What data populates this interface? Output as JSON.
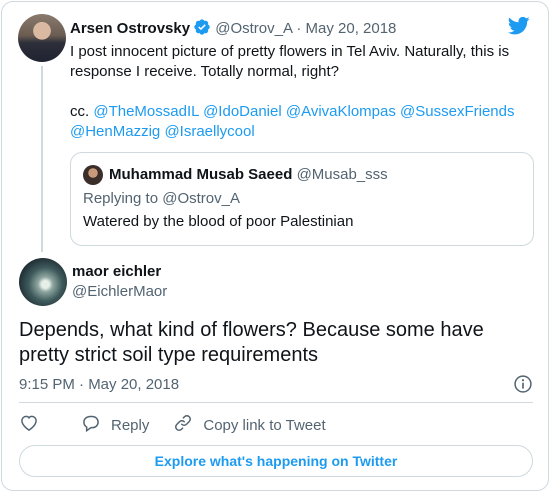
{
  "parent_tweet": {
    "author_name": "Arsen Ostrovsky",
    "author_handle": "@Ostrov_A",
    "separator": "·",
    "date": "May 20, 2018",
    "text_line1": "I post innocent picture of pretty flowers in Tel Aviv. Naturally, this is response I receive. Totally normal, right?",
    "cc_label": "cc.",
    "mentions": [
      "@TheMossadIL",
      "@IdoDaniel",
      "@AvivaKlompas",
      "@SussexFriends",
      "@HenMazzig",
      "@Israellycool"
    ]
  },
  "quoted_tweet": {
    "author_name": "Muhammad Musab Saeed",
    "author_handle": "@Musab_sss",
    "replying_to": "Replying to @Ostrov_A",
    "text": "Watered by the blood of poor Palestinian"
  },
  "main_tweet": {
    "author_name": "maor eichler",
    "author_handle": "@EichlerMaor",
    "text": "Depends, what kind of flowers? Because some have pretty strict soil type requirements",
    "timestamp": "9:15 PM · May 20, 2018"
  },
  "actions": {
    "reply_label": "Reply",
    "copy_link_label": "Copy link to Tweet"
  },
  "explore_label": "Explore what's happening on Twitter",
  "colors": {
    "accent": "#1d9bf0",
    "muted": "#536471",
    "border": "#cfd9de",
    "text": "#0f1419"
  },
  "icons": [
    "verified-badge-icon",
    "twitter-logo-icon",
    "info-icon",
    "heart-icon",
    "reply-icon",
    "link-icon"
  ]
}
